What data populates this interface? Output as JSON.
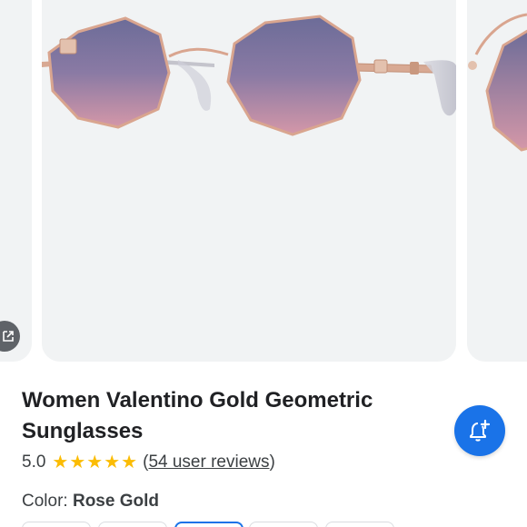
{
  "product": {
    "title": "Women Valentino Gold Geometric Sunglasses",
    "rating": "5.0",
    "stars": 5,
    "review_open": "(",
    "review_link": "54 user reviews",
    "review_close": ")",
    "color_label": "Color:",
    "color_value": "Rose Gold"
  },
  "icons": {
    "share": "open-in-new-icon",
    "alert": "add-alert-bell-icon",
    "star": "star-icon"
  },
  "colors": {
    "accent": "#1a73e8",
    "star": "#fbbc04",
    "card_bg": "#f1f3f4"
  },
  "swatches": {
    "count": 5,
    "selected_index": 2
  }
}
